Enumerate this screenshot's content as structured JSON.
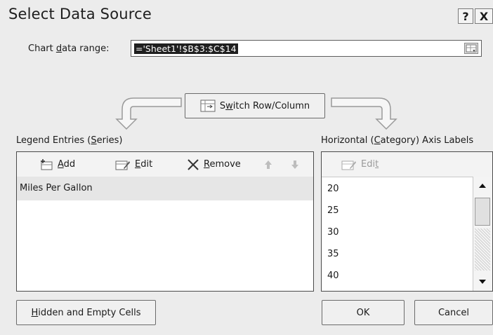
{
  "dialog": {
    "title": "Select Data Source",
    "help_label": "?",
    "close_label": "X"
  },
  "range": {
    "label_pre": "Chart ",
    "label_accel": "d",
    "label_post": "ata range:",
    "value": "='Sheet1'!$B$3:$C$14"
  },
  "switch_button": {
    "pre": "S",
    "accel": "w",
    "post": "itch Row/Column"
  },
  "legend": {
    "label_pre": "Legend Entries (",
    "label_accel": "S",
    "label_post": "eries)",
    "toolbar": {
      "add_accel": "A",
      "add_rest": "dd",
      "edit_accel": "E",
      "edit_rest": "dit",
      "remove_accel": "R",
      "remove_rest": "emove"
    },
    "series": [
      "Miles Per Gallon"
    ]
  },
  "axis": {
    "label_pre": "Horizontal (",
    "label_accel": "C",
    "label_post": "ategory) Axis Labels",
    "edit_pre": "Edi",
    "edit_accel": "t",
    "items": [
      "20",
      "25",
      "30",
      "35",
      "40"
    ]
  },
  "buttons": {
    "hidden_accel": "H",
    "hidden_rest": "idden and Empty Cells",
    "ok": "OK",
    "cancel": "Cancel"
  },
  "colors": {
    "background": "#ececec",
    "selected_row": "#e6e6e6",
    "selection_highlight": "#1f1f1f"
  }
}
